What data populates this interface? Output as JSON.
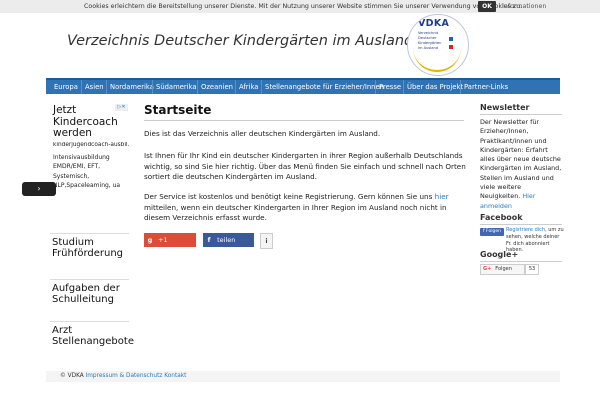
{
  "cookie": {
    "text": "Cookies erleichtern die Bereitstellung unserer Dienste. Mit der Nutzung unserer Website stimmen Sie unserer Verwendung von Cookies zu.",
    "ok": "OK",
    "info": "Informationen"
  },
  "header": {
    "title": "Verzeichnis Deutscher Kindergärten im Ausland",
    "logo_text": "VDKA",
    "logo_sub": "Verzeichnis Deutscher Kindergärten im Ausland"
  },
  "nav": {
    "items": [
      "Europa",
      "Asien",
      "Nordamerika",
      "Südamerika",
      "Ozeanien",
      "Afrika",
      "Stellenangebote für Erzieher/Innen",
      "Presse",
      "Über das Projekt",
      "Partner-Links"
    ]
  },
  "ad": {
    "title": "Jetzt Kindercoach werden",
    "domain": "kinderjugendcoach-ausbil...",
    "body": "Intensivausbildung EMDR/EMI, EFT, Systemisch, NLP,Spaceleaming, ua",
    "button": "›",
    "tiles": [
      "Studium Frühförderung",
      "Aufgaben der Schulleitung",
      "Arzt Stellenangebote"
    ]
  },
  "main": {
    "title": "Startseite",
    "p1": "Dies ist das Verzeichnis aller deutschen Kindergärten im Ausland.",
    "p2": "Ist Ihnen für Ihr Kind ein deutscher Kindergarten in ihrer Region außerhalb Deutschlands wichtig, so sind Sie hier richtig. Über das Menü finden Sie einfach und schnell nach Orten sortiert die deutschen Kindergärten im Ausland.",
    "p3a": "Der Service ist kostenlos und benötigt keine Registrierung. Gern können Sie uns ",
    "p3link": "hier",
    "p3b": " mitteilen, wenn ein deutscher Kindergarten in Ihrer Region im Ausland noch nicht in diesem Verzeichnis erfasst wurde.",
    "share_g": "+1",
    "share_f": "teilen",
    "share_i": "i"
  },
  "sidebar": {
    "newsletter_title": "Newsletter",
    "newsletter_text": "Der Newsletter für Erzieher/Innen, Praktikant/innen und Kindergärten: Erfahrt alles über neue deutsche Kindergärten im Ausland, Stellen im Ausland und viele weitere Neuigkeiten. ",
    "newsletter_link": "Hier anmelden",
    "facebook_title": "Facebook",
    "fb_button": "Folgen",
    "fb_link": "Registriere dich",
    "fb_text": ", um zu sehen, welche deiner Fr. dich abonniert haben.",
    "google_title": "Google+",
    "gp_button": "Folgen",
    "gp_count": "53"
  },
  "footer": {
    "copyright": "© VDKA",
    "link": "Impressum & Datenschutz Kontakt"
  },
  "colors": {
    "nav": "#2f73b5",
    "link": "#2a7ab8",
    "gplus": "#dd4b39",
    "facebook": "#3b5998"
  }
}
